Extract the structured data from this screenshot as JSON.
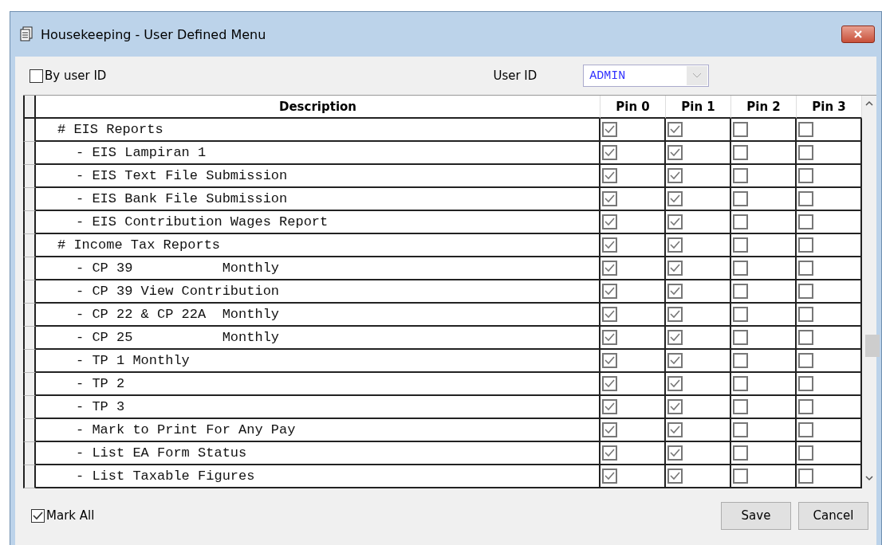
{
  "window": {
    "title": "Housekeeping - User Defined Menu"
  },
  "by_user_id": {
    "label": "By user ID",
    "checked": false
  },
  "user_id": {
    "label": "User ID",
    "value": "ADMIN"
  },
  "table": {
    "columns": [
      "Description",
      "Pin 0",
      "Pin 1",
      "Pin 2",
      "Pin 3"
    ],
    "rows": [
      {
        "label": "# EIS Reports",
        "pins": [
          true,
          true,
          false,
          false
        ],
        "children": [
          {
            "label": "- EIS Lampiran 1",
            "pins": [
              true,
              true,
              false,
              false
            ]
          },
          {
            "label": "- EIS Text File Submission",
            "pins": [
              true,
              true,
              false,
              false
            ]
          },
          {
            "label": "- EIS Bank File Submission",
            "pins": [
              true,
              true,
              false,
              false
            ]
          },
          {
            "label": "- EIS Contribution Wages Report",
            "pins": [
              true,
              true,
              false,
              false
            ]
          }
        ]
      },
      {
        "label": "# Income Tax Reports",
        "pins": [
          true,
          true,
          false,
          false
        ],
        "children": [
          {
            "label": "- CP 39           Monthly",
            "pins": [
              true,
              true,
              false,
              false
            ]
          },
          {
            "label": "- CP 39 View Contribution",
            "pins": [
              true,
              true,
              false,
              false
            ]
          },
          {
            "label": "- CP 22 & CP 22A  Monthly",
            "pins": [
              true,
              true,
              false,
              false
            ]
          },
          {
            "label": "- CP 25           Monthly",
            "pins": [
              true,
              true,
              false,
              false
            ]
          },
          {
            "label": "- TP 1 Monthly",
            "pins": [
              true,
              true,
              false,
              false
            ]
          },
          {
            "label": "- TP 2",
            "pins": [
              true,
              true,
              false,
              false
            ]
          },
          {
            "label": "- TP 3",
            "pins": [
              true,
              true,
              false,
              false
            ]
          },
          {
            "label": "- Mark to Print For Any Pay",
            "pins": [
              true,
              true,
              false,
              false
            ]
          },
          {
            "label": "- List EA Form Status",
            "pins": [
              true,
              true,
              false,
              false
            ]
          },
          {
            "label": "- List Taxable Figures",
            "pins": [
              true,
              true,
              false,
              false
            ]
          }
        ]
      }
    ]
  },
  "mark_all": {
    "label": "Mark All",
    "checked": true
  },
  "buttons": [
    "Save",
    "Cancel"
  ]
}
